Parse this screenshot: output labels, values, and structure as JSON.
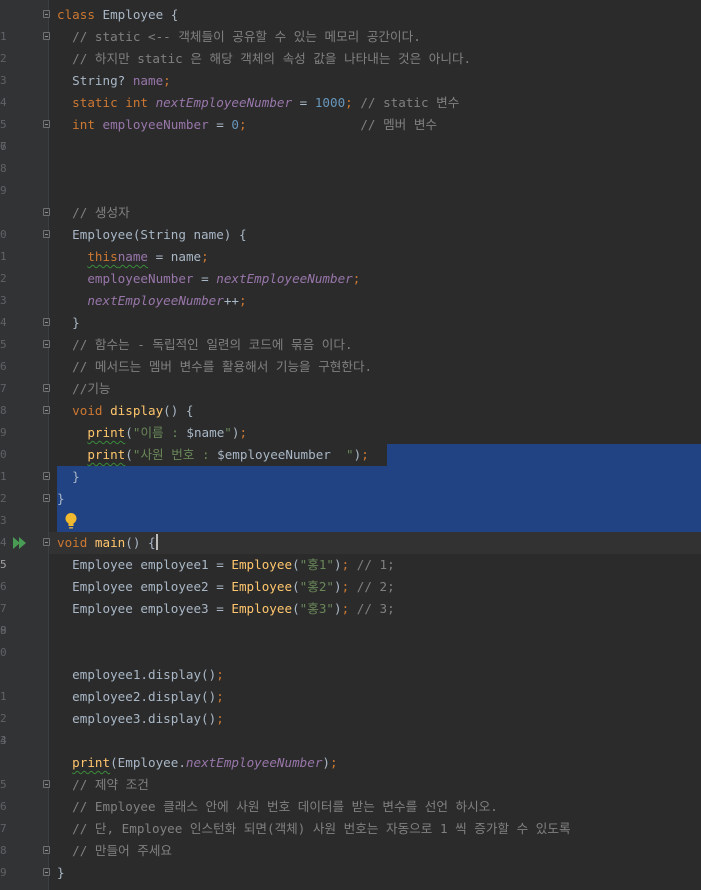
{
  "editor": {
    "line_numbers": [
      "1",
      "2",
      "3",
      "4",
      "5",
      "6",
      "7",
      "8",
      "9",
      "0",
      "1",
      "2",
      "3",
      "4",
      "5",
      "6",
      "7",
      "8",
      "9",
      "0",
      "1",
      "2",
      "3",
      "4",
      "5",
      "6",
      "7",
      "8",
      "9",
      "0",
      "1",
      "2",
      "3",
      "4",
      "5",
      "6",
      "7",
      "8",
      "9",
      "0"
    ],
    "selected_range": "lines 21-24",
    "current_line": "25"
  },
  "code": {
    "l1": {
      "kw": "class",
      "name": " Employee {"
    },
    "l2": "  // static <-- 객체들이 공유할 수 있는 메모리 공간이다.",
    "l3": "  // 하지만 static 은 해당 객체의 속성 값을 나타내는 것은 아니다.",
    "l4": {
      "a": "  String? ",
      "b": "name",
      ";": ";"
    },
    "l5": {
      "indent": "  ",
      "kw1": "static ",
      "kw2": "int ",
      "fld": "nextEmployeeNumber",
      "eq": " = ",
      "num": "1000",
      ";": ";",
      "cm": " // static 변수"
    },
    "l6": {
      "indent": "  ",
      "kw": "int ",
      "fld": "employeeNumber",
      "eq": " = ",
      "num": "0",
      ";": ";",
      "pad": "               ",
      "cm": "// 멤버 변수"
    },
    "l10": "  // 생성자",
    "l11": {
      "a": "  Employee(String name) {"
    },
    "l12": {
      "indent": "    ",
      "kw": "this",
      ".": ".",
      "fld": "name",
      "rest": " = name",
      ";": ";"
    },
    "l13": {
      "indent": "    ",
      "fld": "employeeNumber",
      "eq": " = ",
      "sfld": "nextEmployeeNumber",
      ";": ";"
    },
    "l14": {
      "indent": "    ",
      "sfld": "nextEmployeeNumber",
      "rest": "++",
      ";": ";"
    },
    "l15": "  }",
    "l16": "  // 함수는 - 독립적인 일련의 코드에 묶음 이다.",
    "l17": "  // 메서드는 멤버 변수를 활용해서 기능을 구현한다.",
    "l18": "  //기능",
    "l19": {
      "indent": "  ",
      "kw": "void ",
      "fn": "display",
      "rest": "() {"
    },
    "l20": {
      "indent": "    ",
      "fn": "print",
      "p1": "(",
      "st1": "\"이름 : ",
      "tm": "$name",
      "st2": "\"",
      ")": ")",
      ";": ";"
    },
    "l21": {
      "indent": "    ",
      "fn": "print",
      "p1": "(",
      "st1": "\"사원 번호 : ",
      "tm": "$employeeNumber",
      "st2": "  \"",
      ")": ")",
      ";": ";"
    },
    "l22": "  }",
    "l23": "}",
    "l25": {
      "kw": "void ",
      "fn": "main",
      "rest": "() {"
    },
    "l26": {
      "a": "  Employee employee1 = ",
      "fn": "Employee",
      "p": "(",
      "st": "\"홍1\"",
      "e": ")",
      ";": ";",
      "cm": " // 1;"
    },
    "l27": {
      "a": "  Employee employee2 = ",
      "fn": "Employee",
      "p": "(",
      "st": "\"홍2\"",
      "e": ")",
      ";": ";",
      "cm": " // 2;"
    },
    "l28": {
      "a": "  Employee employee3 = ",
      "fn": "Employee",
      "p": "(",
      "st": "\"홍3\"",
      "e": ")",
      ";": ";",
      "cm": " // 3;"
    },
    "l31": {
      "a": "  employee1.display()",
      ";": ";"
    },
    "l32": {
      "a": "  employee2.display()",
      ";": ";"
    },
    "l33": {
      "a": "  employee3.display()",
      ";": ";"
    },
    "l35": {
      "indent": "  ",
      "fn": "print",
      "a": "(Employee.",
      "sfld": "nextEmployeeNumber",
      "e": ")",
      ";": ";"
    },
    "l36": "  // 제약 조건",
    "l37": "  // Employee 클래스 안에 사원 번호 데이터를 받는 변수를 선언 하시오.",
    "l38": "  // 단, Employee 인스턴화 되면(객체) 사원 번호는 자동으로 1 씩 증가할 수 있도록",
    "l39": "  // 만들어 주세요",
    "l40": "}"
  },
  "colors": {
    "background": "#2b2b2b",
    "selection": "#214283",
    "keyword": "#cc7832",
    "comment": "#808080",
    "function": "#ffc66d",
    "string": "#6a8759",
    "number": "#6897bb",
    "field": "#9876aa"
  },
  "icons": {
    "run": "run-arrow-icon",
    "bulb": "intention-bulb-icon",
    "fold": "fold-marker-icon"
  }
}
